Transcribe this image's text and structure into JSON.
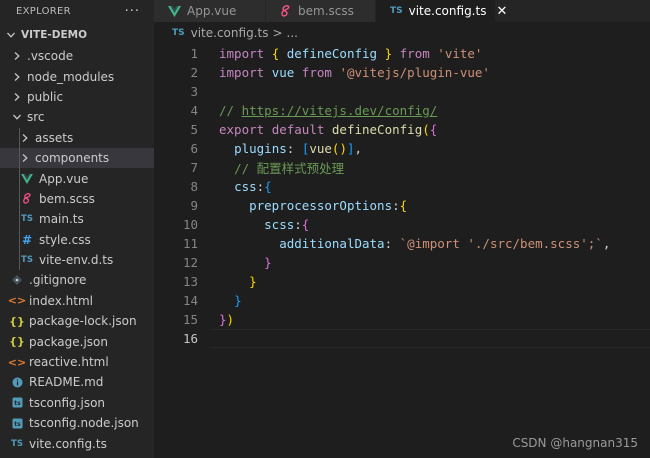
{
  "sidebar": {
    "title": "EXPLORER",
    "more": "···",
    "project": "VITE-DEMO",
    "items": [
      {
        "label": ".vscode",
        "kind": "folder",
        "level": 1
      },
      {
        "label": "node_modules",
        "kind": "folder",
        "level": 1
      },
      {
        "label": "public",
        "kind": "folder",
        "level": 1
      },
      {
        "label": "src",
        "kind": "folder-open",
        "level": 1
      },
      {
        "label": "assets",
        "kind": "folder",
        "level": 2
      },
      {
        "label": "components",
        "kind": "folder",
        "level": 2,
        "selected": true
      },
      {
        "label": "App.vue",
        "kind": "vue",
        "level": 2
      },
      {
        "label": "bem.scss",
        "kind": "scss",
        "level": 2
      },
      {
        "label": "main.ts",
        "kind": "ts",
        "level": 2
      },
      {
        "label": "style.css",
        "kind": "css",
        "level": 2
      },
      {
        "label": "vite-env.d.ts",
        "kind": "ts",
        "level": 2
      },
      {
        "label": ".gitignore",
        "kind": "git",
        "level": 1
      },
      {
        "label": "index.html",
        "kind": "html",
        "level": 1
      },
      {
        "label": "package-lock.json",
        "kind": "json",
        "level": 1
      },
      {
        "label": "package.json",
        "kind": "json",
        "level": 1
      },
      {
        "label": "reactive.html",
        "kind": "html",
        "level": 1
      },
      {
        "label": "README.md",
        "kind": "md",
        "level": 1
      },
      {
        "label": "tsconfig.json",
        "kind": "tsconfig",
        "level": 1
      },
      {
        "label": "tsconfig.node.json",
        "kind": "tsconfig",
        "level": 1
      },
      {
        "label": "vite.config.ts",
        "kind": "ts",
        "level": 1
      }
    ]
  },
  "tabs": [
    {
      "label": "App.vue",
      "kind": "vue",
      "active": false
    },
    {
      "label": "bem.scss",
      "kind": "scss",
      "active": false
    },
    {
      "label": "vite.config.ts",
      "kind": "ts",
      "active": true,
      "close": "✕"
    }
  ],
  "breadcrumb": {
    "file": "vite.config.ts",
    "separator": ">",
    "rest": "..."
  },
  "editor": {
    "current_line": 16,
    "lines": [
      {
        "n": "1"
      },
      {
        "n": "2"
      },
      {
        "n": "3"
      },
      {
        "n": "4"
      },
      {
        "n": "5"
      },
      {
        "n": "6"
      },
      {
        "n": "7"
      },
      {
        "n": "8"
      },
      {
        "n": "9"
      },
      {
        "n": "10"
      },
      {
        "n": "11"
      },
      {
        "n": "12"
      },
      {
        "n": "13"
      },
      {
        "n": "14"
      },
      {
        "n": "15"
      },
      {
        "n": "16"
      }
    ],
    "tokens": {
      "import": "import",
      "from": "from",
      "brace_open": "{",
      "brace_close": "}",
      "defineConfig": "defineConfig",
      "vite_str": "'vite'",
      "vue": "vue",
      "plugin_str": "'@vitejs/plugin-vue'",
      "comment_slash": "// ",
      "comment_url": "https://vitejs.dev/config/",
      "export": "export",
      "default": "default",
      "paren_open": "(",
      "paren_close": ")",
      "plugins": "plugins",
      "colon": ":",
      "bracket_open": "[",
      "bracket_close": "]",
      "vue_call": "vue",
      "comma": ",",
      "comment_cn": "// 配置样式预处理",
      "css": "css",
      "preprocessorOptions": "preprocessorOptions",
      "scss": "scss",
      "additionalData": "additionalData",
      "template_str": "`@import './src/bem.scss';`"
    }
  },
  "watermark": "CSDN @hangnan315",
  "colors": {
    "accent": "#007acc",
    "editor_bg": "#1e1e1e",
    "sidebar_bg": "#252526"
  }
}
